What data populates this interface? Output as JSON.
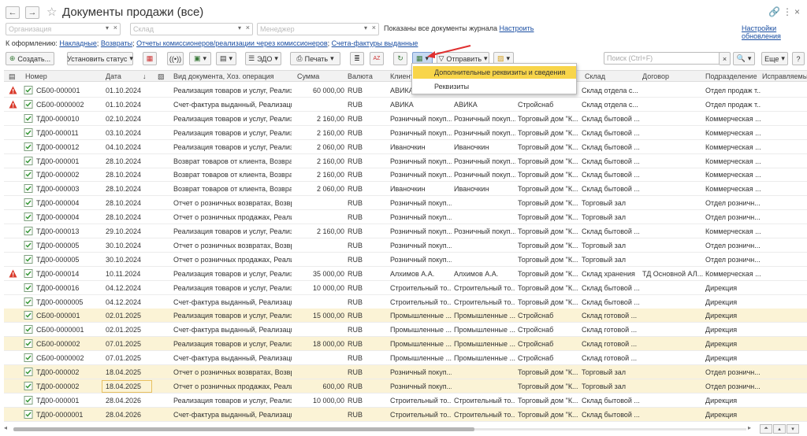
{
  "header": {
    "title": "Документы продажи (все)",
    "back": "←",
    "forward": "→"
  },
  "filters": {
    "organization_placeholder": "Организация",
    "warehouse_placeholder": "Склад",
    "manager_placeholder": "Менеджер",
    "info_text": "Показаны все документы журнала",
    "info_link": "Настроить",
    "settings_link": "Настройки обновления"
  },
  "kof": {
    "label": "К оформлению:",
    "links": [
      "Накладные",
      "Возвраты",
      "Отчеты комиссионеров/реализации через комиссионеров",
      "Счета-фактуры выданные"
    ]
  },
  "toolbar": {
    "create": "Создать...",
    "set_status": "Установить статус",
    "edo": "ЭДО",
    "print": "Печать",
    "send": "Отправить",
    "search_placeholder": "Поиск (Ctrl+F)",
    "more": "Еще",
    "help": "?"
  },
  "popup": {
    "items": [
      "Дополнительные реквизиты и сведения",
      "Реквизиты"
    ]
  },
  "columns": [
    "Номер",
    "Дата",
    "Вид документа, Хоз. операция",
    "Сумма",
    "Валюта",
    "Клиент",
    "Склад",
    "Договор",
    "Подразделение",
    "Исправляемы"
  ],
  "rows": [
    {
      "warn": true,
      "hl": false,
      "num": "СБ00-000001",
      "date": "01.10.2024",
      "kind": "Реализация товаров и услуг, Реализа...",
      "sum": "60 000,00",
      "cur": "RUB",
      "client": "АВИКА",
      "c2": "",
      "c3": "",
      "sklad": "Склад отдела с...",
      "dog": "",
      "pod": "Отдел продаж т..."
    },
    {
      "warn": true,
      "hl": false,
      "num": "СБ00-0000002",
      "date": "01.10.2024",
      "kind": "Счет-фактура выданный, Реализация",
      "sum": "",
      "cur": "RUB",
      "client": "АВИКА",
      "c2": "АВИКА",
      "c3": "Стройснаб",
      "sklad": "Склад отдела с...",
      "dog": "",
      "pod": "Отдел продаж т..."
    },
    {
      "warn": false,
      "hl": false,
      "num": "ТД00-000010",
      "date": "02.10.2024",
      "kind": "Реализация товаров и услуг, Реализа...",
      "sum": "2 160,00",
      "cur": "RUB",
      "client": "Розничный покуп...",
      "c2": "Розничный покуп...",
      "c3": "Торговый дом \"К...",
      "sklad": "Склад бытовой ...",
      "dog": "",
      "pod": "Коммерческая ..."
    },
    {
      "warn": false,
      "hl": false,
      "num": "ТД00-000011",
      "date": "03.10.2024",
      "kind": "Реализация товаров и услуг, Реализа...",
      "sum": "2 160,00",
      "cur": "RUB",
      "client": "Розничный покуп...",
      "c2": "Розничный покуп...",
      "c3": "Торговый дом \"К...",
      "sklad": "Склад бытовой ...",
      "dog": "",
      "pod": "Коммерческая ..."
    },
    {
      "warn": false,
      "hl": false,
      "num": "ТД00-000012",
      "date": "04.10.2024",
      "kind": "Реализация товаров и услуг, Реализа...",
      "sum": "2 060,00",
      "cur": "RUB",
      "client": "Иваночкин",
      "c2": "Иваночкин",
      "c3": "Торговый дом \"К...",
      "sklad": "Склад бытовой ...",
      "dog": "",
      "pod": "Коммерческая ..."
    },
    {
      "warn": false,
      "hl": false,
      "num": "ТД00-000001",
      "date": "28.10.2024",
      "kind": "Возврат товаров от клиента, Возврат ...",
      "sum": "2 160,00",
      "cur": "RUB",
      "client": "Розничный покуп...",
      "c2": "Розничный покуп...",
      "c3": "Торговый дом \"К...",
      "sklad": "Склад бытовой ...",
      "dog": "",
      "pod": "Коммерческая ..."
    },
    {
      "warn": false,
      "hl": false,
      "num": "ТД00-000002",
      "date": "28.10.2024",
      "kind": "Возврат товаров от клиента, Возврат ...",
      "sum": "2 160,00",
      "cur": "RUB",
      "client": "Розничный покуп...",
      "c2": "Розничный покуп...",
      "c3": "Торговый дом \"К...",
      "sklad": "Склад бытовой ...",
      "dog": "",
      "pod": "Коммерческая ..."
    },
    {
      "warn": false,
      "hl": false,
      "num": "ТД00-000003",
      "date": "28.10.2024",
      "kind": "Возврат товаров от клиента, Возврат ...",
      "sum": "2 060,00",
      "cur": "RUB",
      "client": "Иваночкин",
      "c2": "Иваночкин",
      "c3": "Торговый дом \"К...",
      "sklad": "Склад бытовой ...",
      "dog": "",
      "pod": "Коммерческая ..."
    },
    {
      "warn": false,
      "hl": false,
      "num": "ТД00-000004",
      "date": "28.10.2024",
      "kind": "Отчет о розничных возвратах, Возвра...",
      "sum": "",
      "cur": "RUB",
      "client": "Розничный покуп...",
      "c2": "",
      "c3": "Торговый дом \"К...",
      "sklad": "Торговый зал",
      "dog": "",
      "pod": "Отдел розничн..."
    },
    {
      "warn": false,
      "hl": false,
      "num": "ТД00-000004",
      "date": "28.10.2024",
      "kind": "Отчет о розничных продажах, Реализ...",
      "sum": "",
      "cur": "RUB",
      "client": "Розничный покуп...",
      "c2": "",
      "c3": "Торговый дом \"К...",
      "sklad": "Торговый зал",
      "dog": "",
      "pod": "Отдел розничн..."
    },
    {
      "warn": false,
      "hl": false,
      "num": "ТД00-000013",
      "date": "29.10.2024",
      "kind": "Реализация товаров и услуг, Реализа...",
      "sum": "2 160,00",
      "cur": "RUB",
      "client": "Розничный покуп...",
      "c2": "Розничный покуп...",
      "c3": "Торговый дом \"К...",
      "sklad": "Склад бытовой ...",
      "dog": "",
      "pod": "Коммерческая ..."
    },
    {
      "warn": false,
      "hl": false,
      "num": "ТД00-000005",
      "date": "30.10.2024",
      "kind": "Отчет о розничных возвратах, Возвра...",
      "sum": "",
      "cur": "RUB",
      "client": "Розничный покуп...",
      "c2": "",
      "c3": "Торговый дом \"К...",
      "sklad": "Торговый зал",
      "dog": "",
      "pod": "Отдел розничн..."
    },
    {
      "warn": false,
      "hl": false,
      "num": "ТД00-000005",
      "date": "30.10.2024",
      "kind": "Отчет о розничных продажах, Реализ...",
      "sum": "",
      "cur": "RUB",
      "client": "Розничный покуп...",
      "c2": "",
      "c3": "Торговый дом \"К...",
      "sklad": "Торговый зал",
      "dog": "",
      "pod": "Отдел розничн..."
    },
    {
      "warn": true,
      "hl": false,
      "num": "ТД00-000014",
      "date": "10.11.2024",
      "kind": "Реализация товаров и услуг, Реализа...",
      "sum": "35 000,00",
      "cur": "RUB",
      "client": "Алхимов А.А.",
      "c2": "Алхимов А.А.",
      "c3": "Торговый дом \"К...",
      "sklad": "Склад хранения",
      "dog": "ТД Основной АЛ...",
      "pod": "Коммерческая ..."
    },
    {
      "warn": false,
      "hl": false,
      "num": "ТД00-000016",
      "date": "04.12.2024",
      "kind": "Реализация товаров и услуг, Реализа...",
      "sum": "10 000,00",
      "cur": "RUB",
      "client": "Строительный то...",
      "c2": "Строительный то...",
      "c3": "Торговый дом \"К...",
      "sklad": "Склад бытовой ...",
      "dog": "",
      "pod": "Дирекция"
    },
    {
      "warn": false,
      "hl": false,
      "num": "ТД00-0000005",
      "date": "04.12.2024",
      "kind": "Счет-фактура выданный, Реализация",
      "sum": "",
      "cur": "RUB",
      "client": "Строительный то...",
      "c2": "Строительный то...",
      "c3": "Торговый дом \"К...",
      "sklad": "Склад бытовой ...",
      "dog": "",
      "pod": "Дирекция"
    },
    {
      "warn": false,
      "hl": true,
      "num": "СБ00-000001",
      "date": "02.01.2025",
      "kind": "Реализация товаров и услуг, Реализа...",
      "sum": "15 000,00",
      "cur": "RUB",
      "client": "Промышленные ...",
      "c2": "Промышленные ...",
      "c3": "Стройснаб",
      "sklad": "Склад готовой ...",
      "dog": "",
      "pod": "Дирекция"
    },
    {
      "warn": false,
      "hl": false,
      "num": "СБ00-0000001",
      "date": "02.01.2025",
      "kind": "Счет-фактура выданный, Реализация",
      "sum": "",
      "cur": "RUB",
      "client": "Промышленные ...",
      "c2": "Промышленные ...",
      "c3": "Стройснаб",
      "sklad": "Склад готовой ...",
      "dog": "",
      "pod": "Дирекция"
    },
    {
      "warn": false,
      "hl": true,
      "num": "СБ00-000002",
      "date": "07.01.2025",
      "kind": "Реализация товаров и услуг, Реализа...",
      "sum": "18 000,00",
      "cur": "RUB",
      "client": "Промышленные ...",
      "c2": "Промышленные ...",
      "c3": "Стройснаб",
      "sklad": "Склад готовой ...",
      "dog": "",
      "pod": "Дирекция"
    },
    {
      "warn": false,
      "hl": false,
      "num": "СБ00-0000002",
      "date": "07.01.2025",
      "kind": "Счет-фактура выданный, Реализация",
      "sum": "",
      "cur": "RUB",
      "client": "Промышленные ...",
      "c2": "Промышленные ...",
      "c3": "Стройснаб",
      "sklad": "Склад готовой ...",
      "dog": "",
      "pod": "Дирекция"
    },
    {
      "warn": false,
      "hl": true,
      "num": "ТД00-000002",
      "date": "18.04.2025",
      "kind": "Отчет о розничных возвратах, Возвра...",
      "sum": "",
      "cur": "RUB",
      "client": "Розничный покуп...",
      "c2": "",
      "c3": "Торговый дом \"К...",
      "sklad": "Торговый зал",
      "dog": "",
      "pod": "Отдел розничн..."
    },
    {
      "warn": false,
      "hl": true,
      "num": "ТД00-000002",
      "date": "18.04.2025",
      "kind": "Отчет о розничных продажах, Реализ...",
      "sum": "600,00",
      "cur": "RUB",
      "client": "Розничный покуп...",
      "c2": "",
      "c3": "Торговый дом \"К...",
      "sklad": "Торговый зал",
      "dog": "",
      "pod": "Отдел розничн...",
      "datebox": true
    },
    {
      "warn": false,
      "hl": false,
      "num": "ТД00-000001",
      "date": "28.04.2026",
      "kind": "Реализация товаров и услуг, Реализа...",
      "sum": "10 000,00",
      "cur": "RUB",
      "client": "Строительный то...",
      "c2": "Строительный то...",
      "c3": "Торговый дом \"К...",
      "sklad": "Склад бытовой ...",
      "dog": "",
      "pod": "Дирекция"
    },
    {
      "warn": false,
      "hl": true,
      "num": "ТД00-0000001",
      "date": "28.04.2026",
      "kind": "Счет-фактура выданный, Реализация",
      "sum": "",
      "cur": "RUB",
      "client": "Строительный то...",
      "c2": "Строительный то...",
      "c3": "Торговый дом \"К...",
      "sklad": "Склад бытовой ...",
      "dog": "",
      "pod": "Дирекция"
    }
  ]
}
